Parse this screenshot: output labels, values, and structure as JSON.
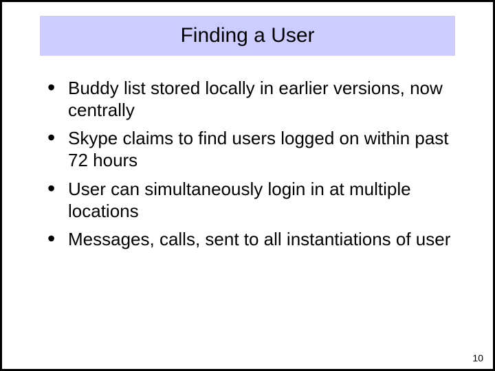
{
  "slide": {
    "title": "Finding a User",
    "bullets": [
      "Buddy list stored locally in earlier versions, now centrally",
      "Skype claims to find users logged on within past 72 hours",
      "User can simultaneously login in at multiple locations",
      "Messages, calls, sent to all instantiations of user"
    ],
    "page_number": "10"
  }
}
